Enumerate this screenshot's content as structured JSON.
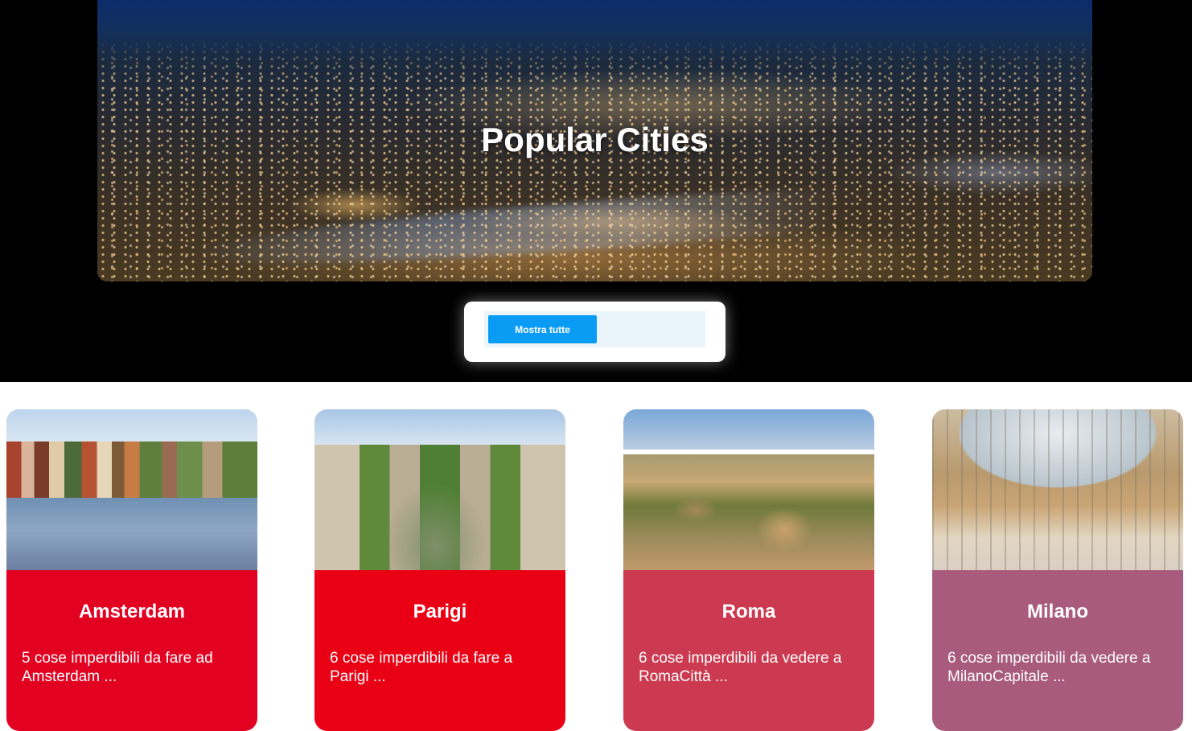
{
  "hero": {
    "title": "Popular Cities"
  },
  "filter": {
    "show_all_label": "Mostra tutte"
  },
  "cities": [
    {
      "name": "Amsterdam",
      "description": "5 cose imperdibili da fare ad Amsterdam ...",
      "color": "#e30121"
    },
    {
      "name": "Parigi",
      "description": "6 cose imperdibili da fare a Parigi ...",
      "color": "#ea0014"
    },
    {
      "name": "Roma",
      "description": "6 cose imperdibili da vedere a RomaCittà ...",
      "color": "#cb3a50"
    },
    {
      "name": "Milano",
      "description": "6 cose imperdibili da vedere a MilanoCapitale ...",
      "color": "#a85b7c"
    }
  ],
  "colors": {
    "page_top_background": "#000000",
    "button": "#0a9cf4",
    "filter_panel": "#e9f4fb"
  }
}
